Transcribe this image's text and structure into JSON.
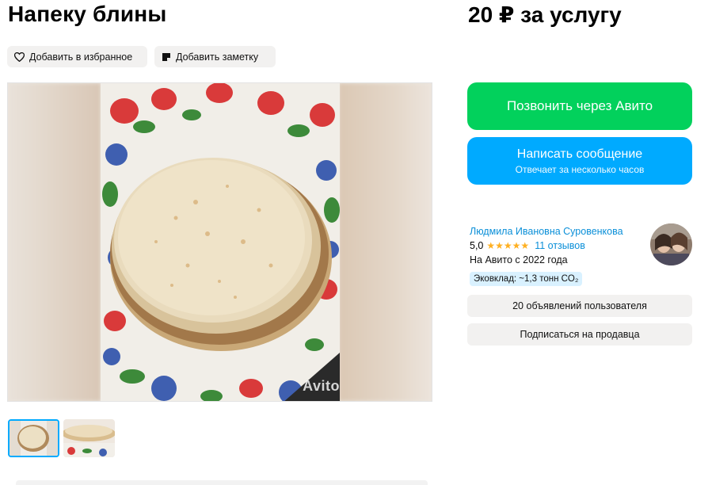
{
  "listing": {
    "title": "Напеку блины",
    "price": "20 ₽ за услугу"
  },
  "actions": {
    "favorite_label": "Добавить в избранное",
    "note_label": "Добавить заметку"
  },
  "gallery": {
    "watermark": "Avito",
    "thumbnail_count": 2,
    "selected_thumbnail": 1
  },
  "contact": {
    "call_label": "Позвонить через Авито",
    "message_label": "Написать сообщение",
    "message_sublabel": "Отвечает за несколько часов"
  },
  "seller": {
    "name": "Людмила Ивановна Суровенкова",
    "rating": "5,0",
    "stars": "★★★★★",
    "reviews": "11 отзывов",
    "since": "На Авито с 2022 года",
    "eco": "Эковклад: ~1,3 тонн CO₂",
    "listings_label": "20 объявлений пользователя",
    "subscribe_label": "Подписаться на продавца"
  },
  "colors": {
    "call_button": "#02d15c",
    "message_button": "#00aaff",
    "link": "#0a8fd8",
    "star": "#ffb021",
    "eco_badge": "#d9f1ff"
  }
}
